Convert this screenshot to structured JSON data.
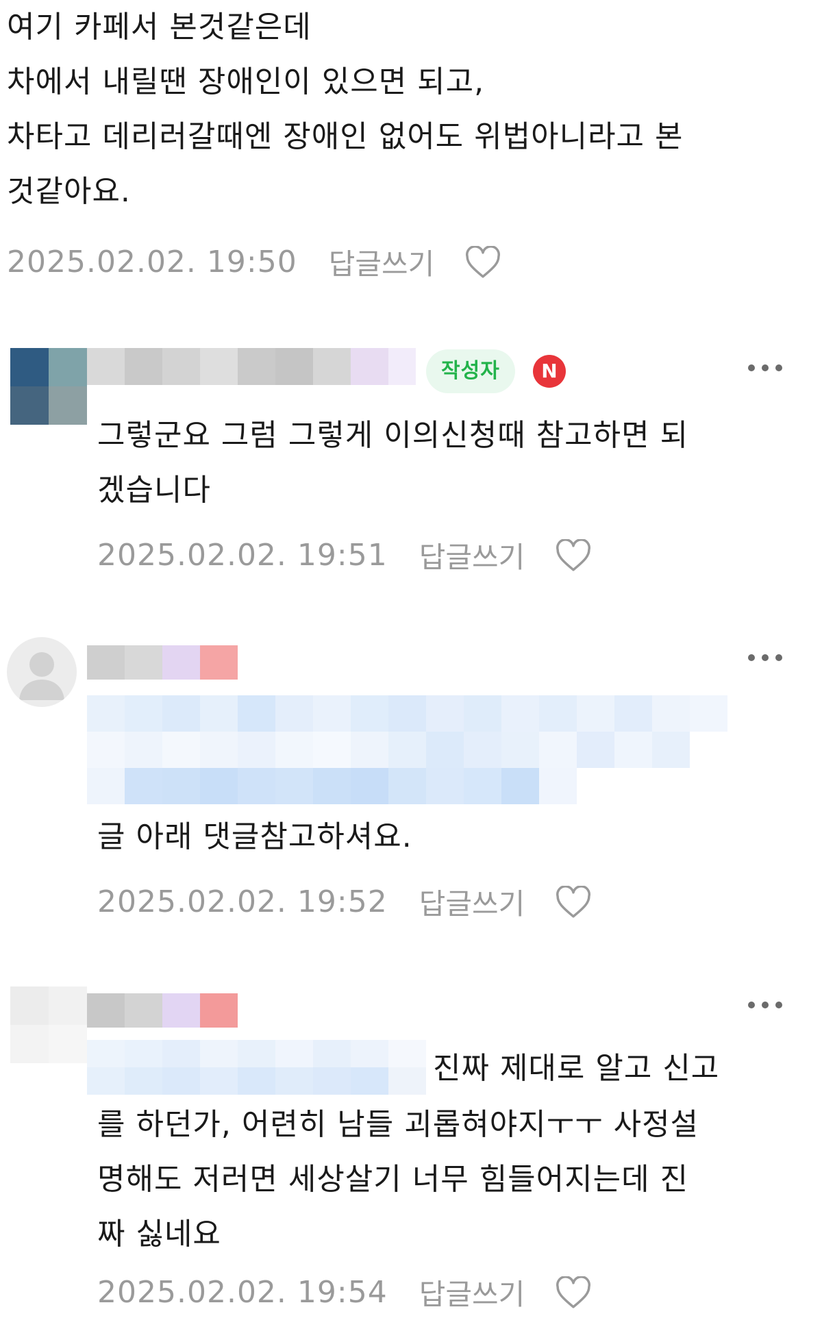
{
  "comments": [
    {
      "text": "여기 카페서 본것같은데\n차에서 내릴땐 장애인이 있으면 되고,\n차타고 데리러갈때엔 장애인 없어도 위법아니라고 본\n것같아요.",
      "date": "2025.02.02. 19:50",
      "reply_label": "답글쓰기"
    },
    {
      "author_badge": "작성자",
      "new_badge": "N",
      "text": "그렇군요 그럼 그렇게 이의신청때 참고하면 되\n겠습니다",
      "date": "2025.02.02. 19:51",
      "reply_label": "답글쓰기"
    },
    {
      "text": "글 아래 댓글참고하셔요.",
      "date": "2025.02.02. 19:52",
      "reply_label": "답글쓰기"
    },
    {
      "text_line1": "진짜 제대로 알고 신고",
      "text": "를 하던가, 어련히 남들 괴롭혀야지ㅜㅜ 사정설\n명해도 저러면 세상살기 너무 힘들어지는데 진\n짜 싫네요",
      "date": "2025.02.02. 19:54",
      "reply_label": "답글쓰기"
    }
  ],
  "icons": {
    "heart": "heart-outline-icon",
    "more": "more-dots-icon",
    "avatar": "default-avatar-icon"
  },
  "colors": {
    "author_badge_bg": "#e9f8ee",
    "author_badge_text": "#23b34b",
    "new_badge": "#e8353a",
    "meta_text": "#9a9a9a"
  }
}
